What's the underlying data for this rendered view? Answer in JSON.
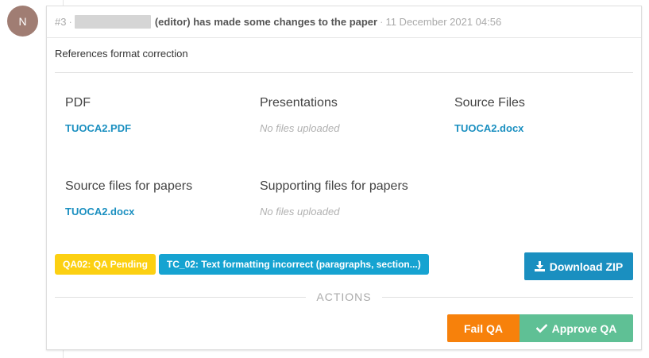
{
  "avatar": {
    "initial": "N"
  },
  "header": {
    "number": "#3",
    "action_text": "(editor) has made some changes to the paper",
    "date": "11 December 2021 04:56"
  },
  "comment": "References format correction",
  "files": [
    {
      "title": "PDF",
      "link": "TUOCA2.PDF"
    },
    {
      "title": "Presentations",
      "empty": "No files uploaded"
    },
    {
      "title": "Source Files",
      "link": "TUOCA2.docx"
    },
    {
      "title": "Source files for papers",
      "link": "TUOCA2.docx"
    },
    {
      "title": "Supporting files for papers",
      "empty": "No files uploaded"
    }
  ],
  "badges": [
    {
      "label": "QA02: QA Pending",
      "color": "#fcd012"
    },
    {
      "label": "TC_02: Text formatting incorrect (paragraphs, section...)",
      "color": "#16a3d1"
    }
  ],
  "download": {
    "label": "Download ZIP",
    "icon": "download-icon"
  },
  "actions": {
    "label": "ACTIONS",
    "fail_label": "Fail QA",
    "approve_label": "Approve QA",
    "approve_icon": "check-icon"
  }
}
